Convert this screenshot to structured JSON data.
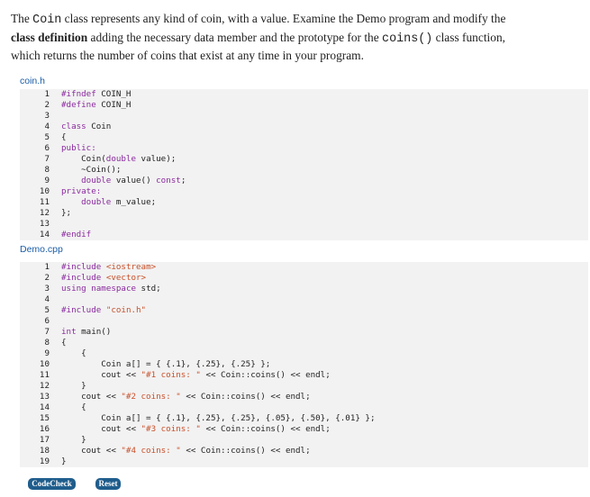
{
  "description": {
    "p1": "The ",
    "code1": "Coin",
    "p2": " class represents any kind of coin, with a value. Examine the Demo program and modify the",
    "bold": "class definition",
    "p3": " adding the necessary data member and the prototype for the ",
    "code2": "coins()",
    "p4": " class function,",
    "p5": "which returns the number of coins that exist at any time in your program."
  },
  "files": [
    {
      "name": "coin.h",
      "lines": [
        {
          "n": "1",
          "segs": [
            {
              "t": "#ifndef",
              "c": "kw"
            },
            {
              "t": " COIN_H",
              "c": ""
            }
          ]
        },
        {
          "n": "2",
          "segs": [
            {
              "t": "#define",
              "c": "kw"
            },
            {
              "t": " COIN_H",
              "c": ""
            }
          ]
        },
        {
          "n": "3",
          "segs": []
        },
        {
          "n": "4",
          "segs": [
            {
              "t": "class",
              "c": "kw"
            },
            {
              "t": " Coin",
              "c": ""
            }
          ]
        },
        {
          "n": "5",
          "segs": [
            {
              "t": "{",
              "c": ""
            }
          ]
        },
        {
          "n": "6",
          "segs": [
            {
              "t": "public:",
              "c": "kw"
            }
          ]
        },
        {
          "n": "7",
          "segs": [
            {
              "t": "    Coin(",
              "c": ""
            },
            {
              "t": "double",
              "c": "kw"
            },
            {
              "t": " value);",
              "c": ""
            }
          ]
        },
        {
          "n": "8",
          "segs": [
            {
              "t": "    ~Coin();",
              "c": ""
            }
          ]
        },
        {
          "n": "9",
          "segs": [
            {
              "t": "    ",
              "c": ""
            },
            {
              "t": "double",
              "c": "kw"
            },
            {
              "t": " value() ",
              "c": ""
            },
            {
              "t": "const",
              "c": "kw"
            },
            {
              "t": ";",
              "c": ""
            }
          ]
        },
        {
          "n": "10",
          "segs": [
            {
              "t": "private:",
              "c": "kw"
            }
          ]
        },
        {
          "n": "11",
          "segs": [
            {
              "t": "    ",
              "c": ""
            },
            {
              "t": "double",
              "c": "kw"
            },
            {
              "t": " m_value;",
              "c": ""
            }
          ]
        },
        {
          "n": "12",
          "segs": [
            {
              "t": "};",
              "c": ""
            }
          ]
        },
        {
          "n": "13",
          "segs": []
        },
        {
          "n": "14",
          "segs": [
            {
              "t": "#endif",
              "c": "kw"
            }
          ]
        }
      ]
    },
    {
      "name": "Demo.cpp",
      "lines": [
        {
          "n": "1",
          "segs": [
            {
              "t": "#include",
              "c": "kw"
            },
            {
              "t": " ",
              "c": ""
            },
            {
              "t": "<iostream>",
              "c": "str"
            }
          ]
        },
        {
          "n": "2",
          "segs": [
            {
              "t": "#include",
              "c": "kw"
            },
            {
              "t": " ",
              "c": ""
            },
            {
              "t": "<vector>",
              "c": "str"
            }
          ]
        },
        {
          "n": "3",
          "segs": [
            {
              "t": "using",
              "c": "kw"
            },
            {
              "t": " ",
              "c": ""
            },
            {
              "t": "namespace",
              "c": "kw"
            },
            {
              "t": " std;",
              "c": ""
            }
          ]
        },
        {
          "n": "4",
          "segs": []
        },
        {
          "n": "5",
          "segs": [
            {
              "t": "#include",
              "c": "kw"
            },
            {
              "t": " ",
              "c": ""
            },
            {
              "t": "\"coin.h\"",
              "c": "str"
            }
          ]
        },
        {
          "n": "6",
          "segs": []
        },
        {
          "n": "7",
          "segs": [
            {
              "t": "int",
              "c": "kw"
            },
            {
              "t": " main()",
              "c": ""
            }
          ]
        },
        {
          "n": "8",
          "segs": [
            {
              "t": "{",
              "c": ""
            }
          ]
        },
        {
          "n": "9",
          "segs": [
            {
              "t": "    {",
              "c": ""
            }
          ]
        },
        {
          "n": "10",
          "segs": [
            {
              "t": "        Coin a[] = { {.1}, {.25}, {.25} };",
              "c": ""
            }
          ]
        },
        {
          "n": "11",
          "segs": [
            {
              "t": "        cout << ",
              "c": ""
            },
            {
              "t": "\"#1 coins: \"",
              "c": "str"
            },
            {
              "t": " << Coin::coins() << endl;",
              "c": ""
            }
          ]
        },
        {
          "n": "12",
          "segs": [
            {
              "t": "    }",
              "c": ""
            }
          ]
        },
        {
          "n": "13",
          "segs": [
            {
              "t": "    cout << ",
              "c": ""
            },
            {
              "t": "\"#2 coins: \"",
              "c": "str"
            },
            {
              "t": " << Coin::coins() << endl;",
              "c": ""
            }
          ]
        },
        {
          "n": "14",
          "segs": [
            {
              "t": "    {",
              "c": ""
            }
          ]
        },
        {
          "n": "15",
          "segs": [
            {
              "t": "        Coin a[] = { {.1}, {.25}, {.25}, {.05}, {.50}, {.01} };",
              "c": ""
            }
          ]
        },
        {
          "n": "16",
          "segs": [
            {
              "t": "        cout << ",
              "c": ""
            },
            {
              "t": "\"#3 coins: \"",
              "c": "str"
            },
            {
              "t": " << Coin::coins() << endl;",
              "c": ""
            }
          ]
        },
        {
          "n": "17",
          "segs": [
            {
              "t": "    }",
              "c": ""
            }
          ]
        },
        {
          "n": "18",
          "segs": [
            {
              "t": "    cout << ",
              "c": ""
            },
            {
              "t": "\"#4 coins: \"",
              "c": "str"
            },
            {
              "t": " << Coin::coins() << endl;",
              "c": ""
            }
          ]
        },
        {
          "n": "19",
          "segs": [
            {
              "t": "}",
              "c": ""
            }
          ]
        }
      ]
    }
  ],
  "buttons": {
    "codecheck": "CodeCheck",
    "reset": "Reset"
  },
  "colors": {
    "keyword": "#8a2a9e",
    "string": "#c8502a",
    "file_label": "#1a5da8",
    "code_bg": "#f2f2f2",
    "button_bg": "#1f5d8c"
  }
}
